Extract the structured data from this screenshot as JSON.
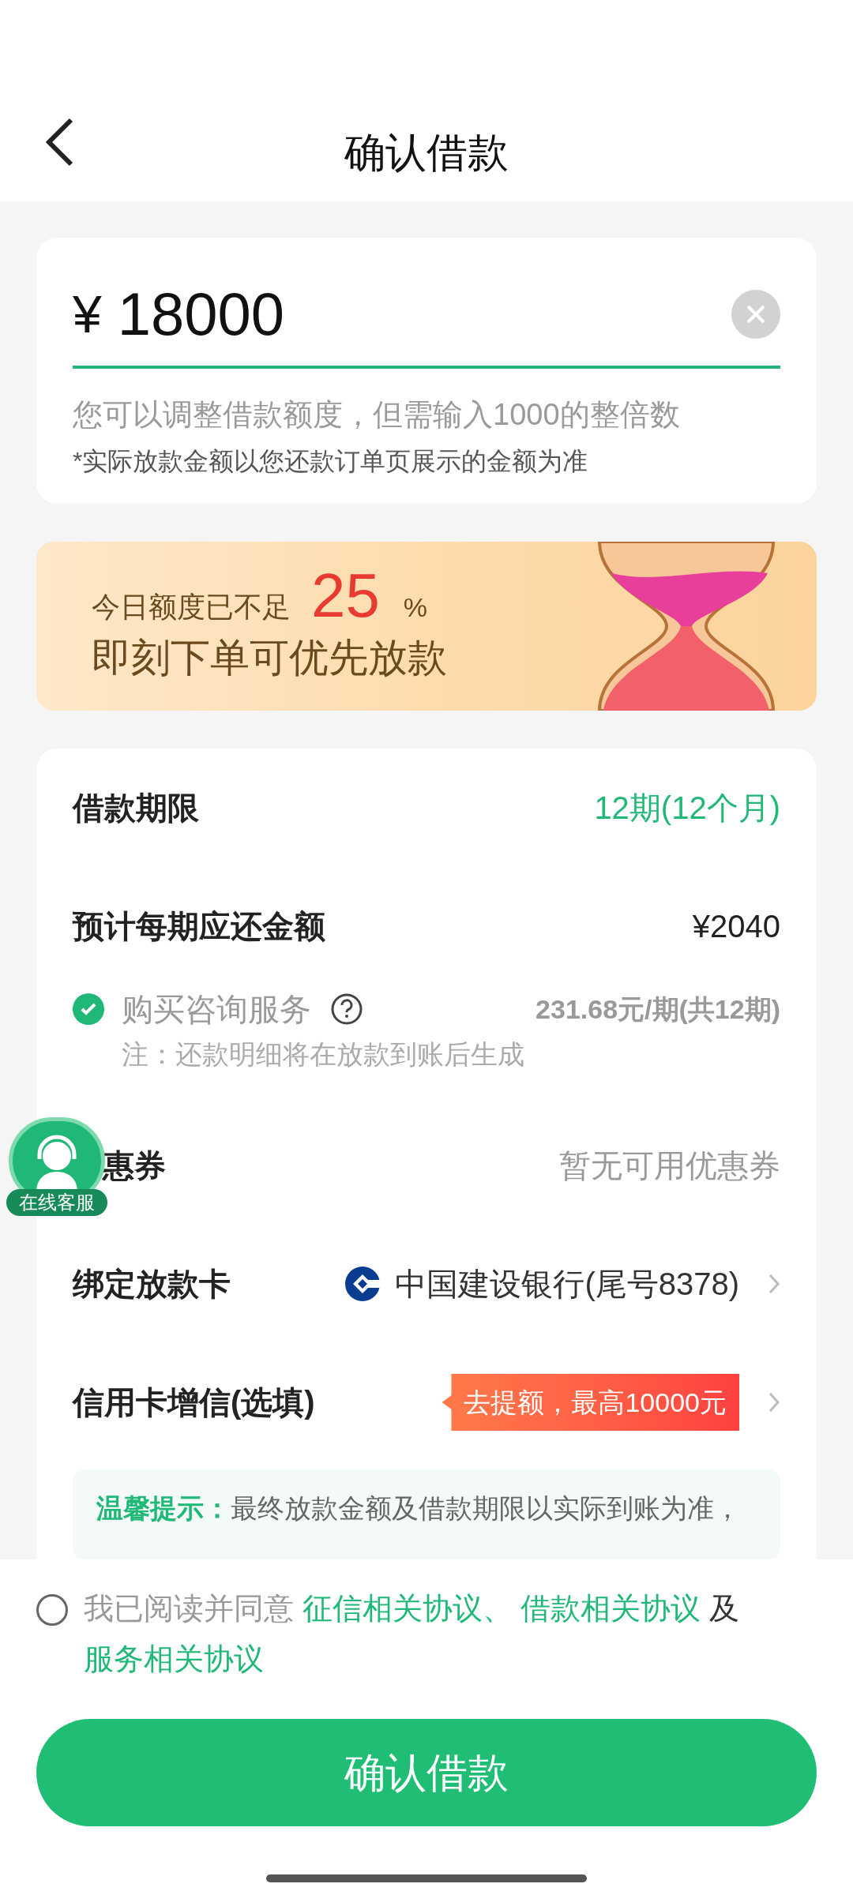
{
  "header": {
    "title": "确认借款"
  },
  "amount_card": {
    "currency": "¥",
    "value": "18000",
    "hint": "您可以调整借款额度，但需输入1000的整倍数",
    "note": "*实际放款金额以您还款订单页展示的金额为准"
  },
  "banner": {
    "prefix": "今日额度已不足",
    "percent": "25",
    "percent_sign": "%",
    "line2": "即刻下单可优先放款"
  },
  "rows": [
    {
      "kind": "highlight",
      "label": "借款期限",
      "value": "12期(12个月)"
    },
    {
      "kind": "value",
      "label": "预计每期应还金额",
      "value": "¥2040"
    },
    {
      "kind": "service",
      "label": "购买咨询服务",
      "checked": true,
      "price": "231.68元/期(共12期)",
      "note": "注：还款明细将在放款到账后生成"
    },
    {
      "kind": "placeholder",
      "label": "惠券",
      "value": "暂无可用优惠券"
    },
    {
      "kind": "card",
      "label": "绑定放款卡",
      "bank": "中国建设银行(尾号8378)"
    },
    {
      "kind": "promo",
      "label": "信用卡增信(选填)",
      "badge": "去提额，最高10000元"
    }
  ],
  "tip": {
    "label": "温馨提示：",
    "text": "最终放款金额及借款期限以实际到账为准，"
  },
  "support": {
    "label": "在线客服"
  },
  "agreement": {
    "checked": false,
    "prefix": "我已阅读并同意",
    "links": [
      "征信相关协议、",
      "借款相关协议",
      "服务相关协议"
    ],
    "joiner": "及"
  },
  "confirm_button": {
    "label": "确认借款"
  }
}
